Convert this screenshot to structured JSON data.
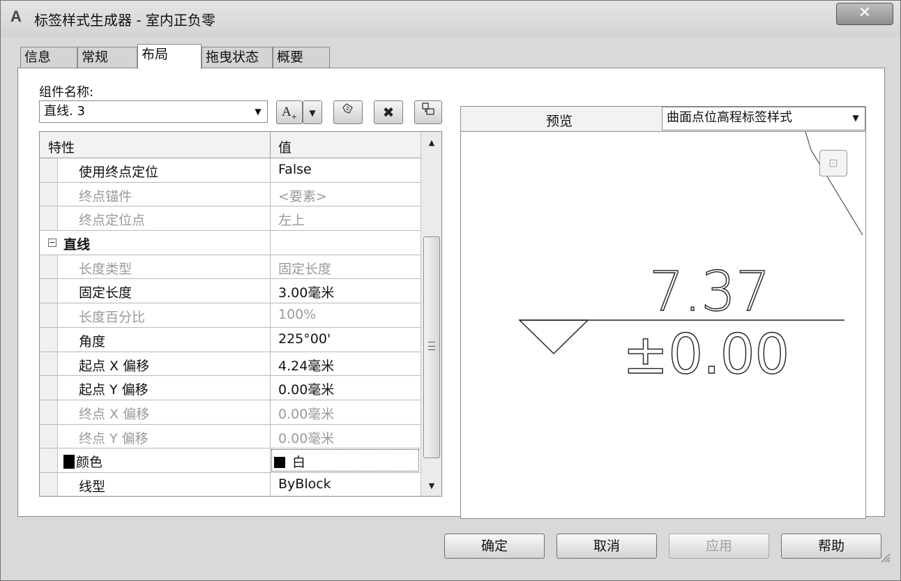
{
  "window": {
    "app_icon": "A",
    "title": "标签样式生成器 - 室内正负零",
    "close_icon": "close-icon"
  },
  "tabs": [
    {
      "label": "信息",
      "active": false
    },
    {
      "label": "常规",
      "active": false
    },
    {
      "label": "布局",
      "active": true
    },
    {
      "label": "拖曳状态",
      "active": false
    },
    {
      "label": "概要",
      "active": false
    }
  ],
  "component": {
    "label": "组件名称:",
    "selected": "直线. 3",
    "add_button_label": "A"
  },
  "grid": {
    "col_property": "特性",
    "col_value": "值",
    "rows": [
      {
        "prop": "使用终点定位",
        "value": "False",
        "dim": false
      },
      {
        "prop": "终点锚件",
        "value": "<要素>",
        "dim": true
      },
      {
        "prop": "终点定位点",
        "value": "左上",
        "dim": true
      },
      {
        "prop": "直线",
        "value": "",
        "dim": false,
        "group": true,
        "expander": "⊟"
      },
      {
        "prop": "长度类型",
        "value": "固定长度",
        "dim": true
      },
      {
        "prop": "固定长度",
        "value": "3.00毫米",
        "dim": false
      },
      {
        "prop": "长度百分比",
        "value": "100%",
        "dim": true
      },
      {
        "prop": "角度",
        "value": "225°00'",
        "dim": false
      },
      {
        "prop": "起点 X 偏移",
        "value": "4.24毫米",
        "dim": false
      },
      {
        "prop": "起点 Y 偏移",
        "value": "0.00毫米",
        "dim": false
      },
      {
        "prop": "终点 X 偏移",
        "value": "0.00毫米",
        "dim": true
      },
      {
        "prop": "终点 Y 偏移",
        "value": "0.00毫米",
        "dim": true
      },
      {
        "prop": "颜色",
        "value": "白",
        "dim": false,
        "swatch": "#000000"
      },
      {
        "prop": "线型",
        "value": "ByBlock",
        "dim": false
      }
    ]
  },
  "preview": {
    "label": "预览",
    "style_selected": "曲面点位高程标签样式",
    "elevation_text": "7.37",
    "zero_text": "±0.00"
  },
  "buttons": {
    "ok": "确定",
    "cancel": "取消",
    "apply": "应用",
    "help": "帮助"
  }
}
